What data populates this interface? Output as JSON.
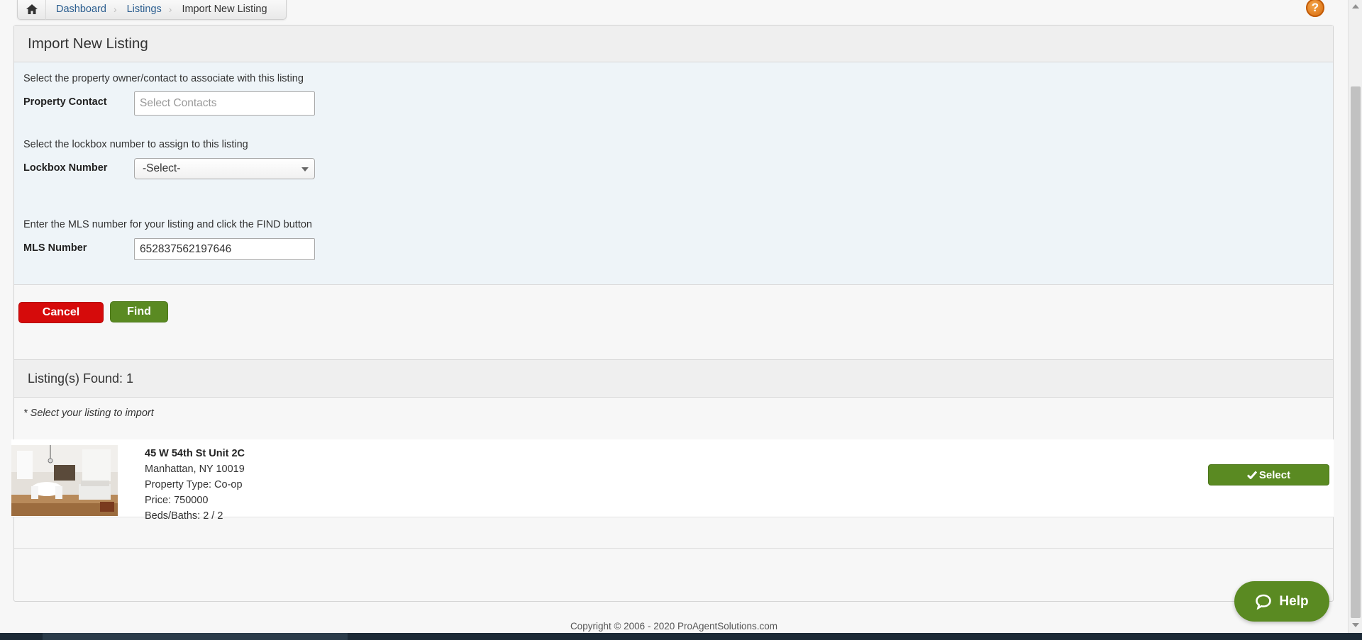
{
  "breadcrumb": {
    "home_icon": "home-icon",
    "items": [
      "Dashboard",
      "Listings",
      "Import New Listing"
    ]
  },
  "help_icon_label": "?",
  "page": {
    "title": "Import New Listing"
  },
  "form": {
    "contact_instruction": "Select the property owner/contact to associate with this listing",
    "contact_label": "Property Contact",
    "contact_placeholder": "Select Contacts",
    "lockbox_instruction": "Select the lockbox number to assign to this listing",
    "lockbox_label": "Lockbox Number",
    "lockbox_selected": "-Select-",
    "mls_instruction": "Enter the MLS number for your listing and click the FIND button",
    "mls_label": "MLS Number",
    "mls_value": "652837562197646"
  },
  "buttons": {
    "cancel": "Cancel",
    "find": "Find"
  },
  "results": {
    "title": "Listing(s) Found: 1",
    "note": "* Select your listing to import",
    "listings": [
      {
        "address": "45 W 54th St Unit 2C",
        "city_state_zip": "Manhattan, NY 10019",
        "property_type": "Property Type: Co-op",
        "price": "Price: 750000",
        "beds_baths": "Beds/Baths: 2 / 2",
        "select_label": "Select"
      }
    ]
  },
  "footer": {
    "copyright": "Copyright © 2006 - 2020 ProAgentSolutions.com"
  },
  "help_widget": {
    "label": "Help",
    "icon": "chat-bubble-icon"
  },
  "colors": {
    "accent_green": "#5a8a22",
    "cancel_red": "#d60b0b",
    "link_blue": "#2a5d8f",
    "help_orange": "#e07b1a"
  }
}
